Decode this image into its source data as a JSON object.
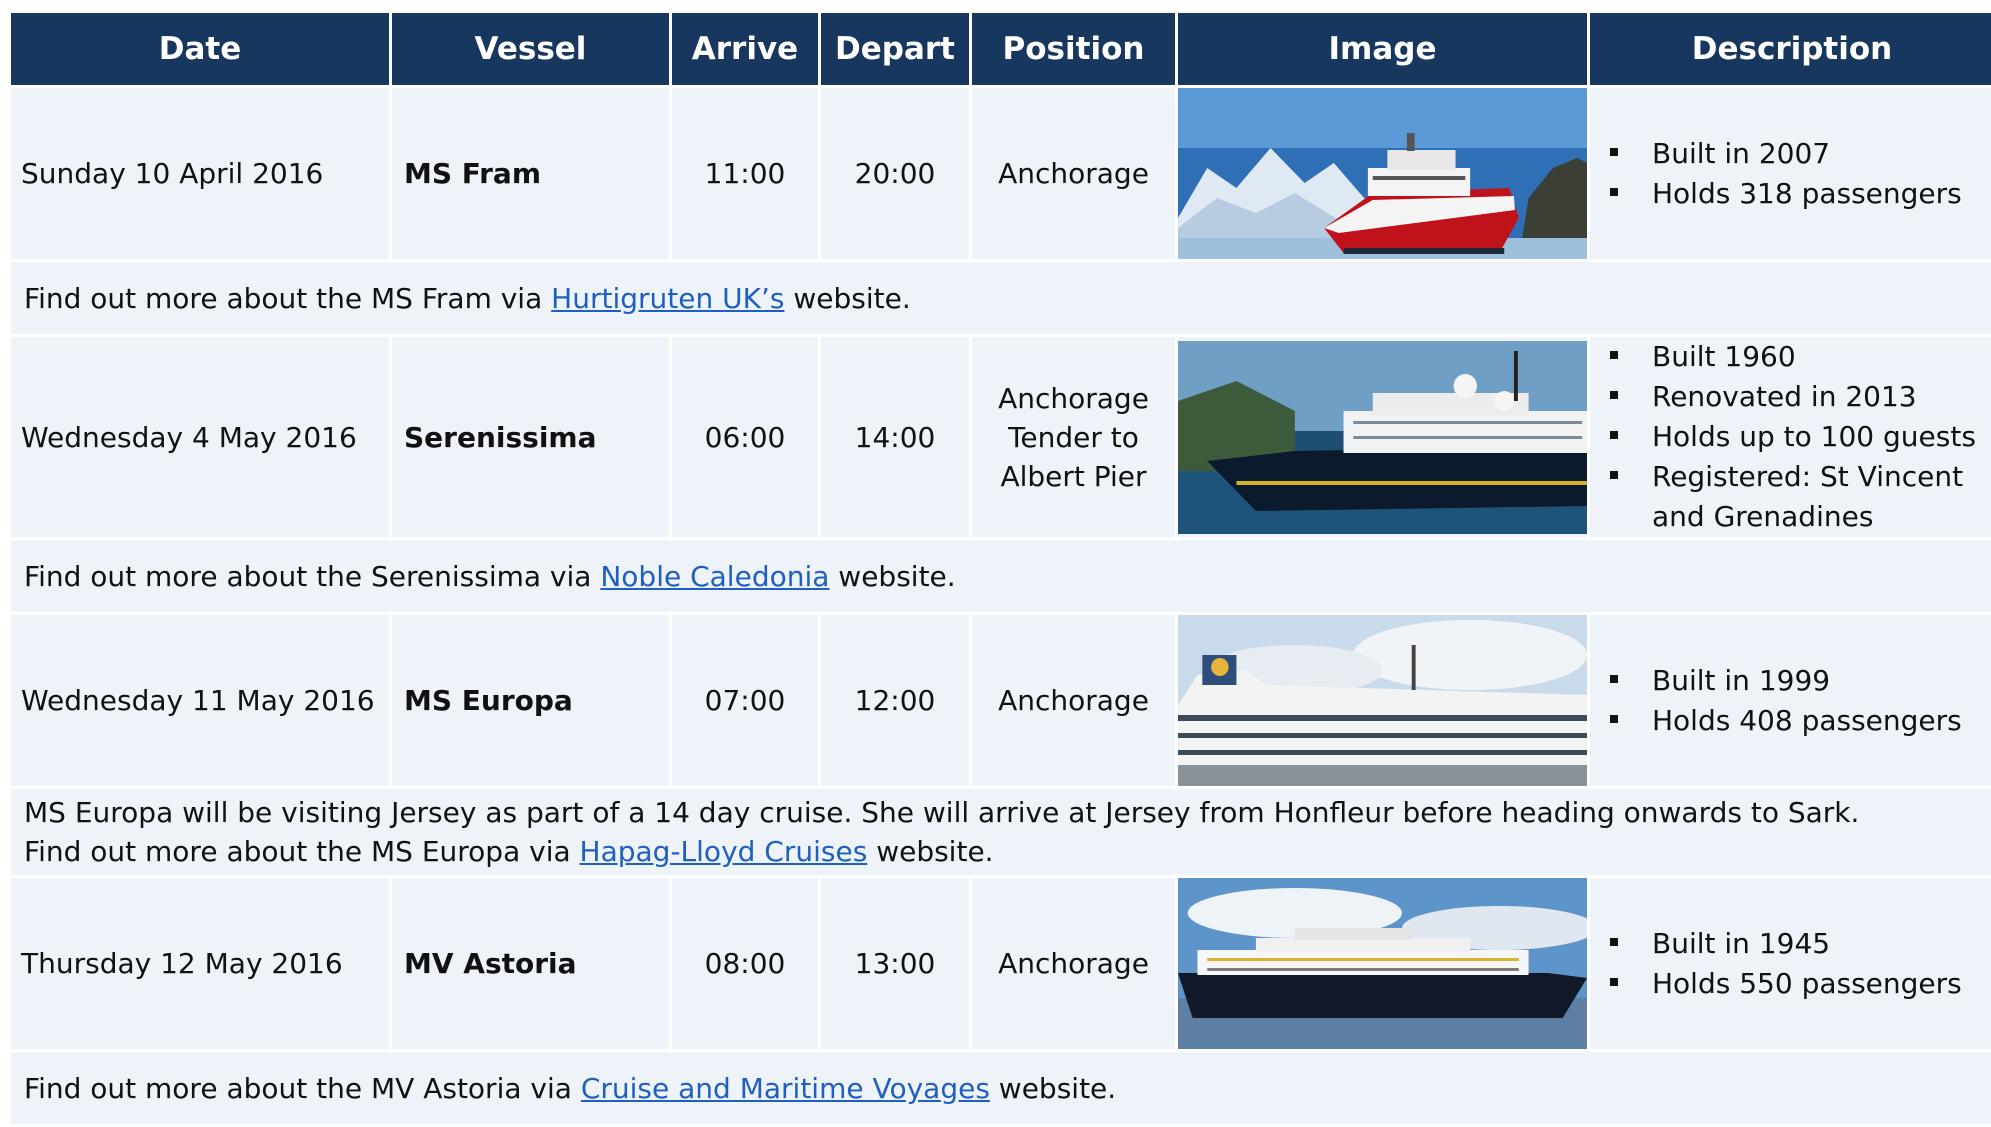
{
  "columns": {
    "date": "Date",
    "vessel": "Vessel",
    "arrive": "Arrive",
    "depart": "Depart",
    "position": "Position",
    "image": "Image",
    "description": "Description"
  },
  "visits": [
    {
      "date": "Sunday 10 April 2016",
      "vessel": "MS Fram",
      "arrive": "11:00",
      "depart": "20:00",
      "position_lines": [
        "Anchorage"
      ],
      "image_icon": "ship-photo-icon",
      "facts": [
        "Built in 2007",
        "Holds 318 passengers"
      ],
      "note_lines": [
        {
          "before": "Find out more about the MS Fram via ",
          "link": "Hurtigruten UK’s",
          "after": " website."
        }
      ]
    },
    {
      "date": "Wednesday 4 May 2016",
      "vessel": "Serenissima",
      "arrive": "06:00",
      "depart": "14:00",
      "position_lines": [
        "Anchorage",
        "Tender to",
        "Albert Pier"
      ],
      "image_icon": "ship-photo-icon",
      "facts": [
        "Built 1960",
        "Renovated in 2013",
        "Holds up to 100 guests",
        "Registered: St Vincent and Grenadines"
      ],
      "note_lines": [
        {
          "before": "Find out more about the Serenissima via ",
          "link": "Noble Caledonia",
          "after": " website."
        }
      ]
    },
    {
      "date": "Wednesday 11 May 2016",
      "vessel": "MS Europa",
      "arrive": "07:00",
      "depart": "12:00",
      "position_lines": [
        "Anchorage"
      ],
      "image_icon": "ship-photo-icon",
      "facts": [
        "Built in 1999",
        "Holds 408 passengers"
      ],
      "note_lines": [
        {
          "before": "MS Europa will be visiting Jersey as part of a 14 day cruise. She will arrive at Jersey from Honfleur before heading onwards to Sark.",
          "link": "",
          "after": ""
        },
        {
          "before": "Find out more about the MS Europa via ",
          "link": "Hapag-Lloyd Cruises",
          "after": " website."
        }
      ]
    },
    {
      "date": "Thursday 12 May 2016",
      "vessel": "MV Astoria",
      "arrive": "08:00",
      "depart": "13:00",
      "position_lines": [
        "Anchorage"
      ],
      "image_icon": "ship-photo-icon",
      "facts": [
        "Built in 1945",
        "Holds 550 passengers"
      ],
      "note_lines": [
        {
          "before": "Find out more about the MV Astoria via ",
          "link": "Cruise and Maritime Voyages",
          "after": " website."
        }
      ]
    }
  ],
  "colors": {
    "header_bg": "#17375e",
    "cell_bg": "#eef3f9",
    "link": "#1f5fbf"
  }
}
